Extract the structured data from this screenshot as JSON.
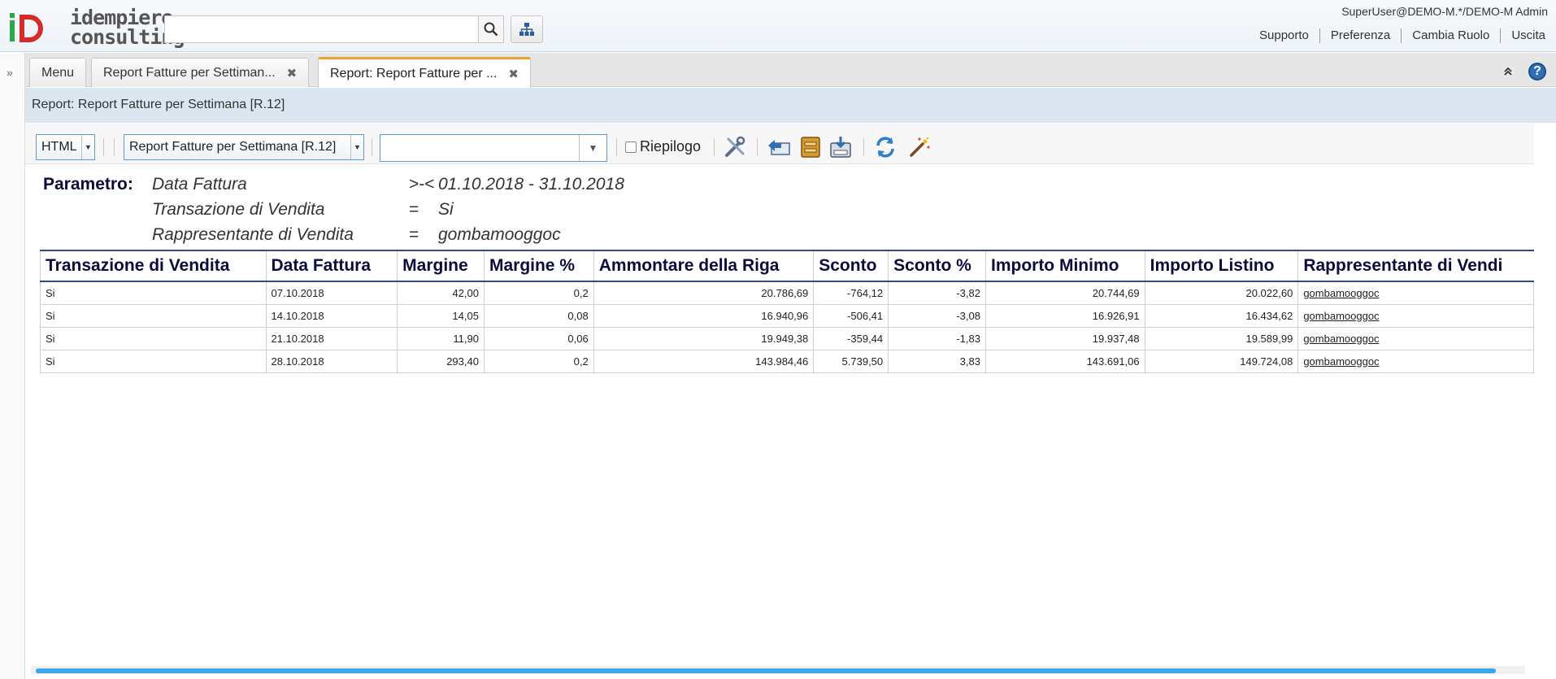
{
  "header": {
    "logo_line1": "idempiere",
    "logo_line2": "consulting",
    "search_placeholder": "",
    "user": "SuperUser@DEMO-M.*/DEMO-M Admin",
    "links": [
      "Supporto",
      "Preferenza",
      "Cambia Ruolo",
      "Uscita"
    ],
    "brand_colors": {
      "green": "#2aa84a",
      "red": "#d82a2a"
    }
  },
  "tabs": [
    {
      "label": "Menu",
      "closable": false
    },
    {
      "label": "Report Fatture per Settiman...",
      "closable": true
    },
    {
      "label": "Report: Report Fatture per ...",
      "closable": true,
      "active": true
    }
  ],
  "title": "Report: Report Fatture per Settimana [R.12]",
  "toolbar": {
    "format": "HTML",
    "report_view": "Report Fatture per Settimana [R.12]",
    "print_format": "",
    "summary_label": "Riepilogo",
    "summary_checked": false
  },
  "params": {
    "heading": "Parametro:",
    "rows": [
      {
        "name": "Data Fattura",
        "op": ">-<",
        "value": "01.10.2018 - 31.10.2018"
      },
      {
        "name": "Transazione di Vendita",
        "op": "=",
        "value": "Si"
      },
      {
        "name": "Rappresentante di Vendita",
        "op": "=",
        "value": "gombamooggoc"
      }
    ]
  },
  "table": {
    "columns": [
      "Transazione di Vendita",
      "Data Fattura",
      "Margine",
      "Margine %",
      "Ammontare della Riga",
      "Sconto",
      "Sconto %",
      "Importo Minimo",
      "Importo Listino",
      "Rappresentante di Vendi"
    ],
    "rows": [
      [
        "Si",
        "07.10.2018",
        "42,00",
        "0,2",
        "20.786,69",
        "-764,12",
        "-3,82",
        "20.744,69",
        "20.022,60",
        "gombamooggoc"
      ],
      [
        "Si",
        "14.10.2018",
        "14,05",
        "0,08",
        "16.940,96",
        "-506,41",
        "-3,08",
        "16.926,91",
        "16.434,62",
        "gombamooggoc"
      ],
      [
        "Si",
        "21.10.2018",
        "11,90",
        "0,06",
        "19.949,38",
        "-359,44",
        "-1,83",
        "19.937,48",
        "19.589,99",
        "gombamooggoc"
      ],
      [
        "Si",
        "28.10.2018",
        "293,40",
        "0,2",
        "143.984,46",
        "5.739,50",
        "3,83",
        "143.691,06",
        "149.724,08",
        "gombamooggoc"
      ]
    ]
  }
}
